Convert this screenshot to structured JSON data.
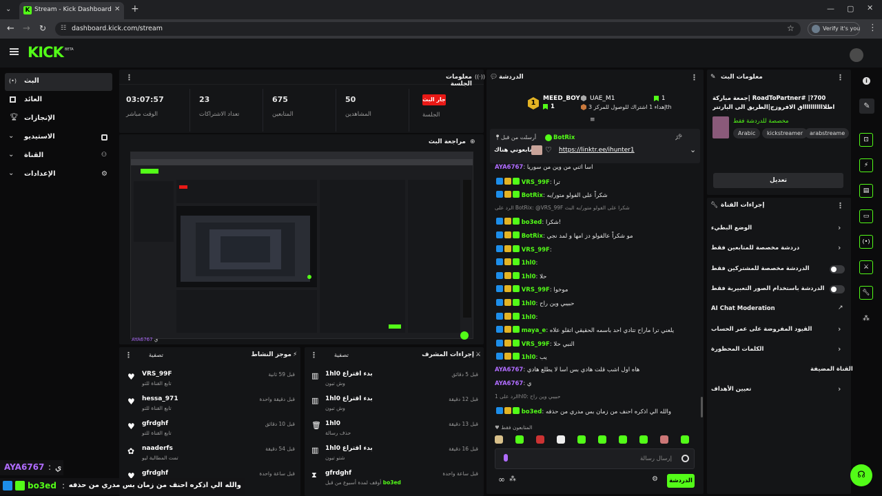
{
  "browser": {
    "tab_title": "Stream - Kick Dashboard",
    "url": "dashboard.kick.com/stream",
    "profile": "Verify it's you"
  },
  "app": {
    "logo": "KICK",
    "beta": "BETA"
  },
  "sidebar": {
    "items": [
      {
        "label": "البث",
        "icon": "live-icon"
      },
      {
        "label": "العائد",
        "icon": "revenue-icon"
      },
      {
        "label": "الإنجازات",
        "icon": "trophy-icon"
      },
      {
        "label": "الاستيديو",
        "icon": "studio-icon"
      },
      {
        "label": "القناة",
        "icon": "channel-icon"
      },
      {
        "label": "الإعدادات",
        "icon": "settings-icon"
      }
    ]
  },
  "session": {
    "title": "معلومات الجلسة",
    "live_badge": "جار البث",
    "live_label": "الجلسة",
    "stats": [
      {
        "value": "50",
        "label": "المشاهدين"
      },
      {
        "value": "675",
        "label": "المتابعين"
      },
      {
        "value": "23",
        "label": "تعداد الاشتراكات"
      },
      {
        "value": "03:07:57",
        "label": "الوقت مباشر"
      }
    ]
  },
  "preview": {
    "title": "مراجعة البث",
    "username": "AYA6767",
    "suffix": "ي"
  },
  "activity": {
    "title": "موجز النشاط",
    "filter": "تصفية",
    "items": [
      {
        "name": "VRS_99F",
        "sub": "تابع القناة للتو",
        "time": "قبل 59 ثانية",
        "icon": "heart-icon"
      },
      {
        "name": "hessa_971",
        "sub": "تابع القناة للتو",
        "time": "قبل دقيقة واحدة",
        "icon": "heart-icon"
      },
      {
        "name": "gfrdghf",
        "sub": "تابع القناة للتو",
        "time": "قبل 10 دقائق",
        "icon": "heart-icon"
      },
      {
        "name": "naaderfs",
        "sub": "تمت المطالبة ليو",
        "time": "قبل 54 دقيقة",
        "icon": "gift-icon"
      },
      {
        "name": "gfrdghf",
        "sub": "",
        "time": "قبل ساعة واحدة",
        "icon": "heart-icon"
      }
    ]
  },
  "modactions": {
    "title": "إجراءات المشرف",
    "filter": "تصفية",
    "items": [
      {
        "name": "1hl0",
        "action": "بدء اقتراع",
        "sub": "وش تبون",
        "time": "قبل 5 دقائق"
      },
      {
        "name": "1hl0",
        "action": "بدء اقتراع",
        "sub": "وش تبون",
        "time": "قبل 12 دقيقة"
      },
      {
        "name": "1hl0",
        "action": "",
        "sub": "حذف رسالة",
        "time": "قبل 13 دقيقة"
      },
      {
        "name": "1hl0",
        "action": "بدء اقتراع",
        "sub": "شتو تبون",
        "time": "قبل 16 دقيقة"
      },
      {
        "name": "gfrdghf",
        "action": "",
        "sub": "أوقف لمدة أسبوع من قبل",
        "by": "bo3ed",
        "time": "قبل ساعة واحدة"
      }
    ]
  },
  "chat": {
    "title": "الدردشة",
    "leader1": {
      "name": "MEED_BOY",
      "count": "1",
      "rank": "1"
    },
    "leader2": {
      "name": "UAE_M1",
      "count": "1",
      "goal": "إهداء 1 اشتراك للوصول للمركز 3",
      "suffix": "th"
    },
    "pinned": {
      "by": "أرسلت من قبل",
      "user": "BotRix",
      "text": "تابعوني هناك",
      "link": "https://linktr.ee/ihunter1"
    },
    "messages": [
      {
        "user": "AYA6767",
        "text": "اسا اثني من وين من سوريا",
        "color": "#b06cff"
      },
      {
        "user": "VRS_99F",
        "text": "ترا",
        "color": "#53fc18"
      },
      {
        "user": "BotRix",
        "text": "شكراً على الفولو متور/به",
        "color": "#53fc18"
      },
      {
        "user": "",
        "text": "الرد على BotRix: @VRS_99F شكرا على الفولو متور/به البث",
        "color": "#999"
      },
      {
        "user": "bo3ed",
        "text": "شكرا!",
        "color": "#53fc18"
      },
      {
        "user": "BotRix",
        "text": "مو شكراً عالفولو دز امها و لمد نجي",
        "color": "#53fc18"
      },
      {
        "user": "VRS_99F",
        "text": "",
        "color": "#53fc18"
      },
      {
        "user": "1hl0",
        "text": "",
        "color": "#53fc18"
      },
      {
        "user": "1hl0",
        "text": "حلا",
        "color": "#53fc18"
      },
      {
        "user": "VRS_99F",
        "text": "موخوا",
        "color": "#53fc18"
      },
      {
        "user": "1hl0",
        "text": "حبيبي وين راح",
        "color": "#53fc18"
      },
      {
        "user": "1hl0",
        "text": "",
        "color": "#53fc18"
      },
      {
        "user": "maya_e",
        "text": "يلعني ترا ماراح تتادي احد باسمه الحقيقي اتقلو علاه",
        "color": "#53fc18"
      },
      {
        "user": "VRS_99F",
        "text": "النبي حلا",
        "color": "#53fc18"
      },
      {
        "user": "1hl0",
        "text": "يب",
        "color": "#53fc18"
      },
      {
        "user": "AYA6767",
        "text": "هاه اول اشب قلت هادي بس اسا لا يطلع هادي",
        "color": "#b06cff"
      },
      {
        "user": "AYA6767",
        "text": "ي",
        "color": "#b06cff"
      },
      {
        "user": "",
        "text": "الرد على 1hl0: حبيبي وين راح",
        "color": "#999"
      },
      {
        "user": "bo3ed",
        "text": "والله الي اذكره احنف من زمان بس مدري من حذفه",
        "color": "#53fc18"
      }
    ],
    "followers_only": "المتابعون فقط",
    "input_placeholder": "إرسال رسالة",
    "send": "الدردشة"
  },
  "streaminfo": {
    "title": "معلومات البث",
    "stream_title": "700?| #RoadToPartner |جمعة مباركة اطلاااااااااااق الافروزج|الطريق الى البارتنر",
    "category": "مخصصة للدردشة فقط",
    "tags": [
      "Arabic",
      "kickstreamer",
      "arabstreame"
    ],
    "edit": "تعديل"
  },
  "channelactions": {
    "title": "إجراءات القناة",
    "items": [
      {
        "label": "الوضع البطيء",
        "control": "chevron"
      },
      {
        "label": "دردشة مخصصة للمتابعين فقط",
        "control": "chevron"
      },
      {
        "label": "الدردشة مخصصة للمشتركين فقط",
        "control": "toggle"
      },
      {
        "label": "الدردشة باستخدام الصور التعبيرية فقط",
        "control": "toggle"
      },
      {
        "label": "AI Chat Moderation",
        "control": "external"
      },
      {
        "label": "القيود المفروضة على عمر الحساب",
        "control": "chevron"
      },
      {
        "label": "الكلمات المحظورة",
        "control": "chevron"
      },
      {
        "label": "القناة المضيفة",
        "control": "none"
      },
      {
        "label": "تعيين الأهداف",
        "control": "chevron"
      }
    ]
  },
  "overlay": {
    "line1_user": "AYA6767",
    "line1_text": "ي",
    "line2_user": "bo3ed",
    "line2_text": "والله الي اذكره احنف من زمان بس مدري من حذفه"
  },
  "colors": {
    "accent": "#53fc18",
    "panel": "#141517",
    "bg": "#0b0b0c",
    "live": "#e91916"
  }
}
